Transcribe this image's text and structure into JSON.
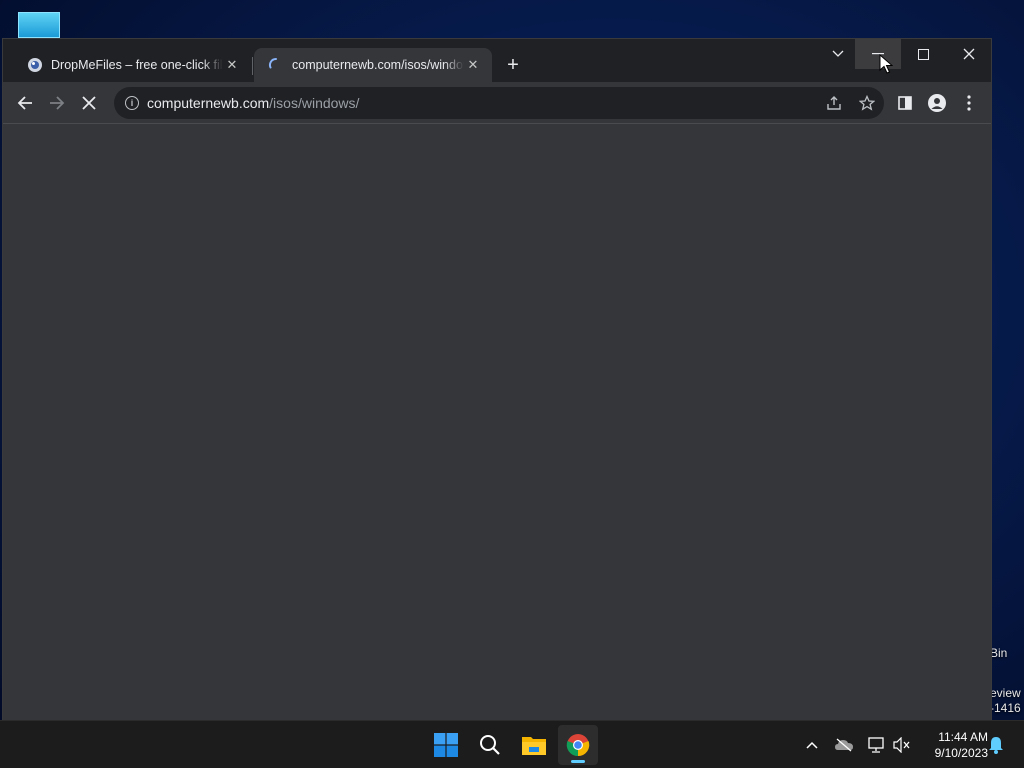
{
  "desktop": {
    "recycle_fragment": "Bin",
    "preview_line1": "eview",
    "preview_line2": "-1416"
  },
  "browser": {
    "tabs": [
      {
        "title": "DropMeFiles – free one-click file",
        "state": "inactive",
        "icon": "dropmefiles-favicon"
      },
      {
        "title": "computernewb.com/isos/windows/",
        "state": "active-loading",
        "icon": "loading-spinner-icon"
      }
    ],
    "new_tab_label": "+",
    "address": {
      "host": "computernewb.com",
      "path": "/isos/windows/"
    },
    "page_state": "loading"
  },
  "taskbar": {
    "time": "11:44 AM",
    "date": "9/10/2023",
    "apps": [
      "start",
      "search",
      "file-explorer",
      "chrome"
    ]
  },
  "colors": {
    "tabstrip": "#202124",
    "toolbar": "#35363a",
    "taskbar": "#1c1c1c",
    "accent": "#60cdff"
  }
}
